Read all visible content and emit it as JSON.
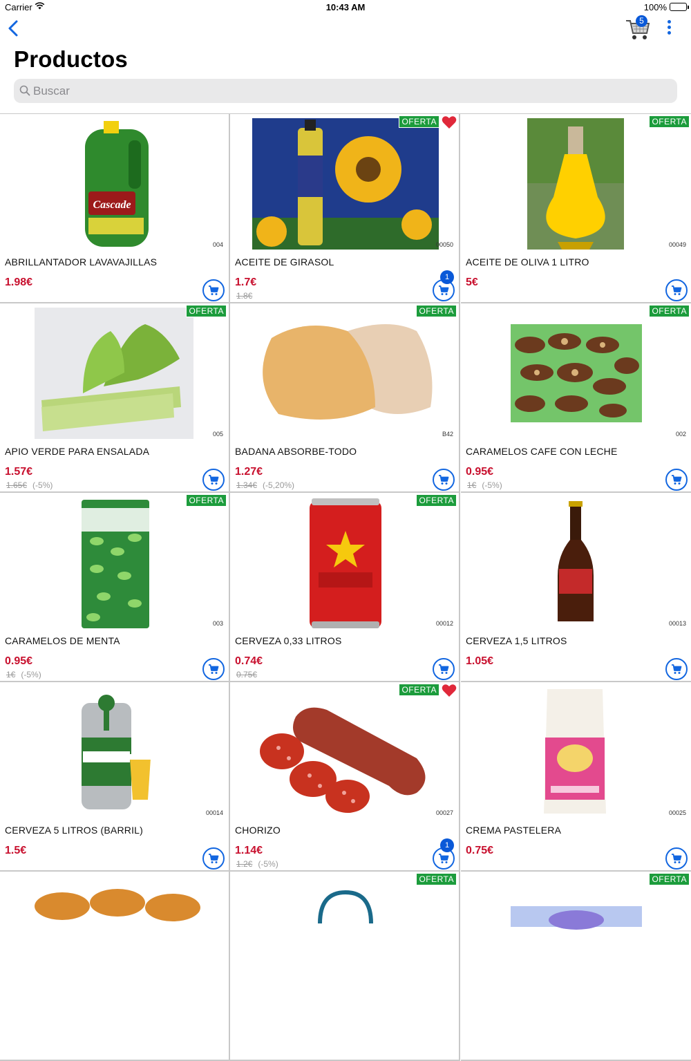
{
  "status": {
    "carrier": "Carrier",
    "time": "10:43 AM",
    "battery": "100%"
  },
  "nav": {
    "cart_count": "5"
  },
  "page_title": "Productos",
  "search": {
    "placeholder": "Buscar"
  },
  "badge_label": "OFERTA",
  "products": [
    {
      "name": "ABRILLANTADOR LAVAVAJILLAS",
      "code": "004",
      "price": "1.98€",
      "old": "",
      "disc": "",
      "oferta": false,
      "fav": false,
      "qty": ""
    },
    {
      "name": "ACEITE DE GIRASOL",
      "code": "00050",
      "price": "1.7€",
      "old": "1.8€",
      "disc": "",
      "oferta": true,
      "fav": true,
      "qty": "1"
    },
    {
      "name": "ACEITE DE OLIVA 1 LITRO",
      "code": "00049",
      "price": "5€",
      "old": "",
      "disc": "",
      "oferta": true,
      "fav": false,
      "qty": ""
    },
    {
      "name": "APIO VERDE PARA ENSALADA",
      "code": "005",
      "price": "1.57€",
      "old": "1.65€",
      "disc": "(-5%)",
      "oferta": true,
      "fav": false,
      "qty": ""
    },
    {
      "name": "BADANA ABSORBE-TODO",
      "code": "B42",
      "price": "1.27€",
      "old": "1.34€",
      "disc": "(-5,20%)",
      "oferta": true,
      "fav": false,
      "qty": ""
    },
    {
      "name": "CARAMELOS CAFE CON LECHE",
      "code": "002",
      "price": "0.95€",
      "old": "1€",
      "disc": "(-5%)",
      "oferta": true,
      "fav": false,
      "qty": ""
    },
    {
      "name": "CARAMELOS DE MENTA",
      "code": "003",
      "price": "0.95€",
      "old": "1€",
      "disc": "(-5%)",
      "oferta": true,
      "fav": false,
      "qty": ""
    },
    {
      "name": "CERVEZA 0,33 LITROS",
      "code": "00012",
      "price": "0.74€",
      "old": "0.75€",
      "disc": "",
      "oferta": true,
      "fav": false,
      "qty": ""
    },
    {
      "name": "CERVEZA 1,5 LITROS",
      "code": "00013",
      "price": "1.05€",
      "old": "",
      "disc": "",
      "oferta": false,
      "fav": false,
      "qty": ""
    },
    {
      "name": "CERVEZA 5 LITROS (BARRIL)",
      "code": "00014",
      "price": "1.5€",
      "old": "",
      "disc": "",
      "oferta": false,
      "fav": false,
      "qty": ""
    },
    {
      "name": "CHORIZO",
      "code": "00027",
      "price": "1.14€",
      "old": "1.2€",
      "disc": "(-5%)",
      "oferta": true,
      "fav": true,
      "qty": "1"
    },
    {
      "name": "CREMA PASTELERA",
      "code": "00025",
      "price": "0.75€",
      "old": "",
      "disc": "",
      "oferta": false,
      "fav": false,
      "qty": ""
    },
    {
      "name": "",
      "code": "",
      "price": "",
      "old": "",
      "disc": "",
      "oferta": false,
      "fav": false,
      "qty": ""
    },
    {
      "name": "",
      "code": "",
      "price": "",
      "old": "",
      "disc": "",
      "oferta": true,
      "fav": false,
      "qty": ""
    },
    {
      "name": "",
      "code": "",
      "price": "",
      "old": "",
      "disc": "",
      "oferta": true,
      "fav": false,
      "qty": ""
    }
  ],
  "colors": {
    "accent": "#1266e0",
    "price": "#c8102e",
    "oferta": "#1c9c3c",
    "heart": "#e0283a"
  }
}
